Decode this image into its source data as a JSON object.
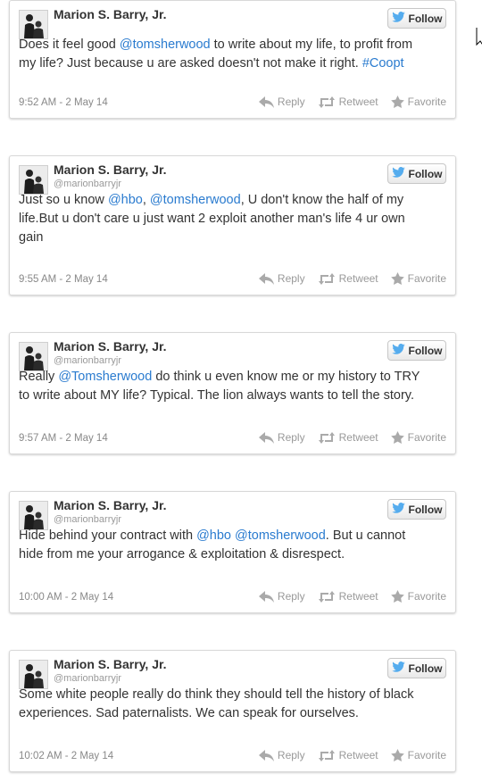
{
  "tweets": [
    {
      "name": "Marion S. Barry, Jr.",
      "handle": "",
      "follow": "Follow",
      "text_lines": [
        [
          {
            "t": "Does it feel good ",
            "link": false
          },
          {
            "t": "@tomsherwood",
            "link": true
          },
          {
            "t": " to write about my life, to profit from",
            "link": false
          }
        ],
        [
          {
            "t": "my life? Just because u are asked doesn't not make it right. ",
            "link": false
          },
          {
            "t": "#Coopt",
            "link": true
          }
        ]
      ],
      "time": "9:52 AM - 2 May 14",
      "reply": "Reply",
      "retweet": "Retweet",
      "favorite": "Favorite"
    },
    {
      "name": "Marion S. Barry, Jr.",
      "handle": "@marionbarryjr",
      "follow": "Follow",
      "text_lines": [
        [
          {
            "t": "Just so u know ",
            "link": false
          },
          {
            "t": "@hbo",
            "link": true
          },
          {
            "t": ", ",
            "link": false
          },
          {
            "t": "@tomsherwood",
            "link": true
          },
          {
            "t": ", U don't know the half of my",
            "link": false
          }
        ],
        [
          {
            "t": "life.But u don't care u just want 2 exploit another man's life 4 ur own",
            "link": false
          }
        ],
        [
          {
            "t": "gain",
            "link": false
          }
        ]
      ],
      "time": "9:55 AM - 2 May 14",
      "reply": "Reply",
      "retweet": "Retweet",
      "favorite": "Favorite"
    },
    {
      "name": "Marion S. Barry, Jr.",
      "handle": "@marionbarryjr",
      "follow": "Follow",
      "text_lines": [
        [
          {
            "t": "Really ",
            "link": false
          },
          {
            "t": "@Tomsherwood",
            "link": true
          },
          {
            "t": " do think u even know me or my history to TRY",
            "link": false
          }
        ],
        [
          {
            "t": "to write about MY life? Typical. The lion always wants to tell the story.",
            "link": false
          }
        ]
      ],
      "time": "9:57 AM - 2 May 14",
      "reply": "Reply",
      "retweet": "Retweet",
      "favorite": "Favorite"
    },
    {
      "name": "Marion S. Barry, Jr.",
      "handle": "@marionbarryjr",
      "follow": "Follow",
      "text_lines": [
        [
          {
            "t": "Hide behind your contract with ",
            "link": false
          },
          {
            "t": "@hbo",
            "link": true
          },
          {
            "t": " ",
            "link": false
          },
          {
            "t": "@tomsherwood",
            "link": true
          },
          {
            "t": ". But u cannot",
            "link": false
          }
        ],
        [
          {
            "t": "hide from me your arrogance & exploitation & disrespect.",
            "link": false
          }
        ]
      ],
      "time": "10:00 AM - 2 May 14",
      "reply": "Reply",
      "retweet": "Retweet",
      "favorite": "Favorite"
    },
    {
      "name": "Marion S. Barry, Jr.",
      "handle": "@marionbarryjr",
      "follow": "Follow",
      "text_lines": [
        [
          {
            "t": "Some white people really do think they should tell the history of black",
            "link": false
          }
        ],
        [
          {
            "t": "experiences. Sad paternalists. We can speak for ourselves.",
            "link": false
          }
        ]
      ],
      "time": "10:02 AM - 2 May 14",
      "reply": "Reply",
      "retweet": "Retweet",
      "favorite": "Favorite"
    }
  ],
  "colors": {
    "link": "#2a7bcf",
    "twitter_bird": "#55acee",
    "text": "#333333",
    "muted": "#999999"
  }
}
